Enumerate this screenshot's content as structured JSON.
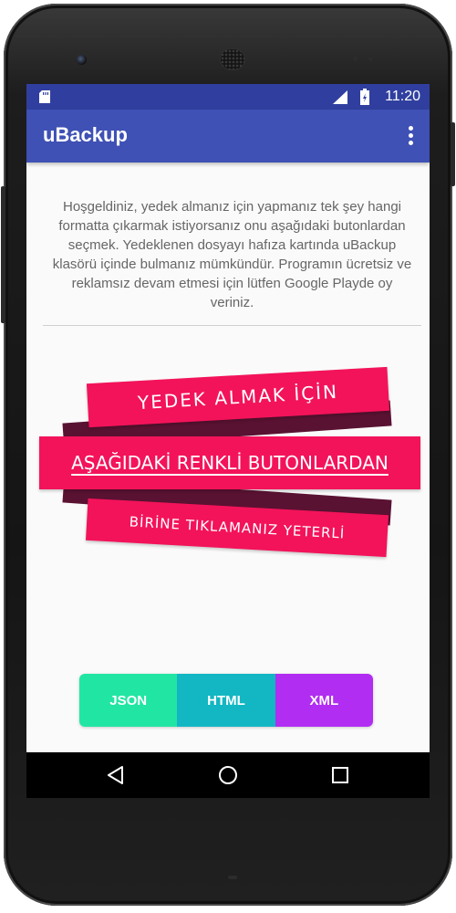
{
  "status_bar": {
    "time": "11:20"
  },
  "app_bar": {
    "title": "uBackup"
  },
  "welcome_text": "Hoşgeldiniz, yedek almanız için yapmanız tek şey hangi formatta çıkarmak istiyorsanız onu aşağıdaki butonlardan seçmek. Yedeklenen dosyayı hafıza kartında uBackup klasörü içinde bulmanız mümkündür. Programın ücretsiz ve reklamsız devam etmesi için lütfen Google Playde oy veriniz.",
  "banner": {
    "line1": "YEDEK ALMAK İÇİN",
    "line2": "AŞAĞIDAKİ RENKLİ BUTONLARDAN",
    "line3": "BİRİNE TIKLAMANIZ YETERLİ"
  },
  "format_buttons": [
    {
      "label": "JSON",
      "color": "#21e6a3"
    },
    {
      "label": "HTML",
      "color": "#12b7c3"
    },
    {
      "label": "XML",
      "color": "#b12df2"
    }
  ],
  "colors": {
    "status_bar": "#303f9f",
    "app_bar": "#3f51b5",
    "banner": "#f3135a"
  },
  "icons": {
    "status": [
      "sd-card-icon",
      "signal-icon",
      "battery-icon"
    ],
    "app_bar": [
      "overflow-menu-icon"
    ],
    "nav": [
      "back-icon",
      "home-icon",
      "recent-apps-icon"
    ]
  }
}
